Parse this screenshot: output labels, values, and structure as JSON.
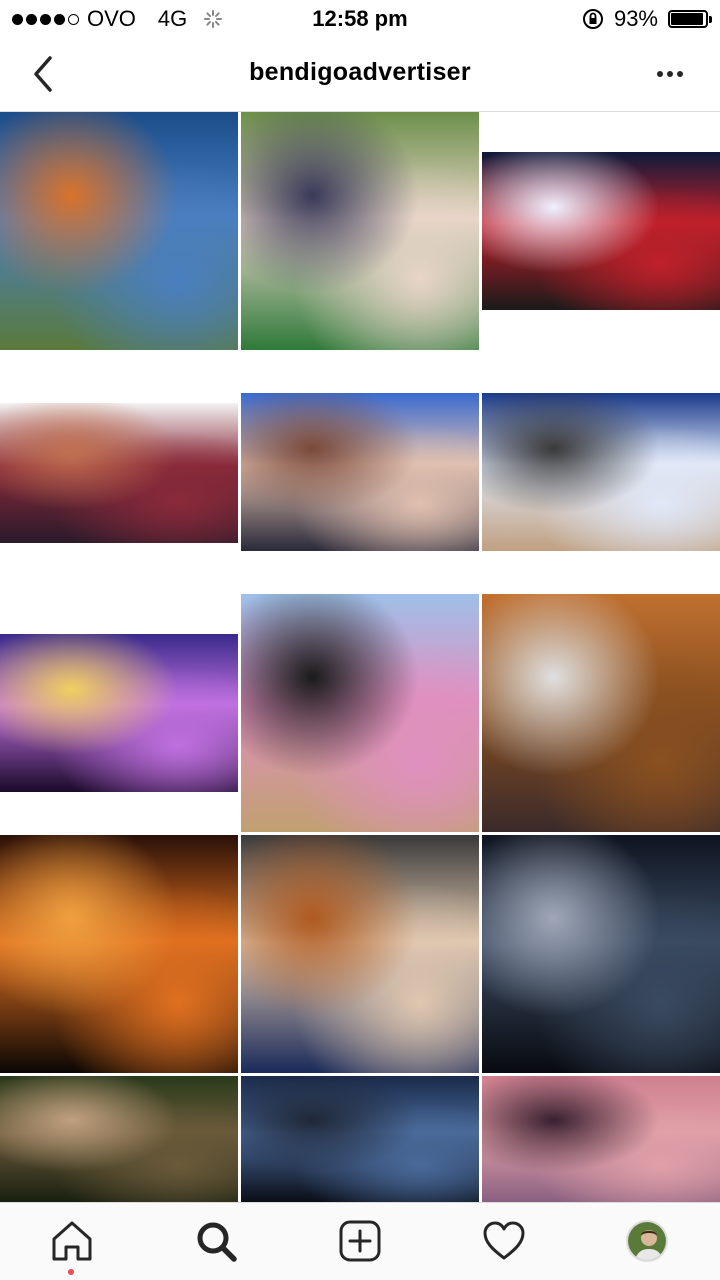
{
  "status_bar": {
    "carrier": "OVO",
    "network": "4G",
    "time": "12:58 pm",
    "battery": "93%",
    "battery_level": 0.93
  },
  "header": {
    "title": "bendigoadvertiser"
  },
  "grid": {
    "tiles": [
      {
        "name": "photo-sunset-grass",
        "colors": [
          "#1b4d8a",
          "#4a7fc0",
          "#d9722a",
          "#5a7a3a"
        ]
      },
      {
        "name": "photo-festival-friends",
        "colors": [
          "#6c8f4a",
          "#e8d5c8",
          "#3a3a5a",
          "#2f7a3a"
        ]
      },
      {
        "name": "photo-concert-stage",
        "colors": [
          "#0e1a3a",
          "#c0202a",
          "#f0f0ff",
          "#1a1a1a"
        ]
      },
      {
        "name": "photo-crowd-hands",
        "colors": [
          "#f2f2f2",
          "#8a2a3a",
          "#c07050",
          "#2a1a2a"
        ]
      },
      {
        "name": "photo-crowd-front",
        "colors": [
          "#3a6ad0",
          "#e0c0b0",
          "#7a4a3a",
          "#2a2a3a"
        ]
      },
      {
        "name": "photo-crowd-surfer",
        "colors": [
          "#1a3a8a",
          "#e0e8f8",
          "#3a3a3a",
          "#c0a080"
        ]
      },
      {
        "name": "photo-tent-lights",
        "colors": [
          "#3a2a8a",
          "#c070e0",
          "#f0d060",
          "#1a0a2a"
        ]
      },
      {
        "name": "photo-pink-hair",
        "colors": [
          "#9ec0e8",
          "#e090c0",
          "#1a1a1a",
          "#c0a070"
        ]
      },
      {
        "name": "photo-dinner-hall",
        "colors": [
          "#c07030",
          "#8a5020",
          "#e0e0e0",
          "#3a2a2a"
        ]
      },
      {
        "name": "photo-orange-sunset",
        "colors": [
          "#2a1008",
          "#e07020",
          "#f0a040",
          "#0a0604"
        ]
      },
      {
        "name": "photo-women-group",
        "colors": [
          "#3a3a3a",
          "#e0c8b0",
          "#b05a20",
          "#1a2a5a"
        ]
      },
      {
        "name": "photo-milky-way",
        "colors": [
          "#0e1420",
          "#3a4a60",
          "#a0a8b8",
          "#080a10"
        ]
      },
      {
        "name": "photo-mushrooms",
        "colors": [
          "#2a3a1a",
          "#6a5a3a",
          "#c0a080",
          "#1a2010"
        ]
      },
      {
        "name": "photo-motorbike-clouds",
        "colors": [
          "#1a2a4a",
          "#4a6a9a",
          "#202838",
          "#0a0e18"
        ]
      },
      {
        "name": "photo-palm-sunset",
        "colors": [
          "#d08090",
          "#e0a0a8",
          "#3a2030",
          "#8a6080"
        ]
      }
    ]
  },
  "nav": {
    "items": [
      "home-icon",
      "search-icon",
      "add-icon",
      "heart-icon",
      "profile-avatar"
    ]
  }
}
